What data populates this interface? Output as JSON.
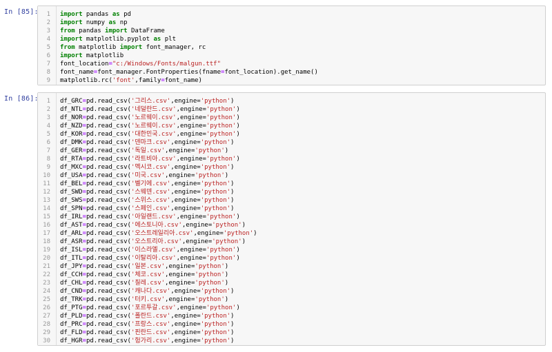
{
  "cells": [
    {
      "prompt": "In [85]:",
      "lines": [
        [
          {
            "t": "import",
            "c": "kw"
          },
          {
            "t": " pandas "
          },
          {
            "t": "as",
            "c": "kw"
          },
          {
            "t": " pd"
          }
        ],
        [
          {
            "t": "import",
            "c": "kw"
          },
          {
            "t": " numpy "
          },
          {
            "t": "as",
            "c": "kw"
          },
          {
            "t": " np"
          }
        ],
        [
          {
            "t": "from",
            "c": "kw"
          },
          {
            "t": " pandas "
          },
          {
            "t": "import",
            "c": "kw"
          },
          {
            "t": " DataFrame"
          }
        ],
        [
          {
            "t": "import",
            "c": "kw"
          },
          {
            "t": " matplotlib.pyplot "
          },
          {
            "t": "as",
            "c": "kw"
          },
          {
            "t": " plt"
          }
        ],
        [
          {
            "t": "from",
            "c": "kw"
          },
          {
            "t": " matplotlib "
          },
          {
            "t": "import",
            "c": "kw"
          },
          {
            "t": " font_manager, rc"
          }
        ],
        [
          {
            "t": "import",
            "c": "kw"
          },
          {
            "t": " matplotlib"
          }
        ],
        [
          {
            "t": "font_location"
          },
          {
            "t": "=",
            "c": "op"
          },
          {
            "t": "\"c:/Windows/Fonts/malgun.ttf\"",
            "c": "str"
          }
        ],
        [
          {
            "t": "font_name"
          },
          {
            "t": "=",
            "c": "op"
          },
          {
            "t": "font_manager.FontProperties(fname"
          },
          {
            "t": "=",
            "c": "op"
          },
          {
            "t": "font_location).get_name()"
          }
        ],
        [
          {
            "t": "matplotlib.rc("
          },
          {
            "t": "'font'",
            "c": "str"
          },
          {
            "t": ",family"
          },
          {
            "t": "=",
            "c": "op"
          },
          {
            "t": "font_name)"
          }
        ]
      ]
    },
    {
      "prompt": "In [86]:",
      "read_csv": [
        {
          "var": "df_GRC",
          "file": "그리스.csv"
        },
        {
          "var": "df_NTL",
          "file": "네덜란드.csv"
        },
        {
          "var": "df_NOR",
          "file": "노르웨이.csv"
        },
        {
          "var": "df_NZD",
          "file": "노르웨이.csv"
        },
        {
          "var": "df_KOR",
          "file": "대한민국.csv"
        },
        {
          "var": "df_DMK",
          "file": "덴마크.csv"
        },
        {
          "var": "df_GER",
          "file": "독일.csv"
        },
        {
          "var": "df_RTA",
          "file": "라트비아.csv"
        },
        {
          "var": "df_MXC",
          "file": "멕시코.csv"
        },
        {
          "var": "df_USA",
          "file": "미국.csv"
        },
        {
          "var": "df_BEL",
          "file": "벨기에.csv"
        },
        {
          "var": "df_SWD",
          "file": "스웨덴.csv"
        },
        {
          "var": "df_SWS",
          "file": "스위스.csv"
        },
        {
          "var": "df_SPN",
          "file": "스페인.csv"
        },
        {
          "var": "df_IRL",
          "file": "아일랜드.csv"
        },
        {
          "var": "df_AST",
          "file": "에스토니아.csv"
        },
        {
          "var": "df_ARL",
          "file": "오스트레일리아.csv"
        },
        {
          "var": "df_ASR",
          "file": "오스트리아.csv"
        },
        {
          "var": "df_ISL",
          "file": "이스라엘.csv"
        },
        {
          "var": "df_ITL",
          "file": "이탈리아.csv"
        },
        {
          "var": "df_JPY",
          "file": "일본.csv"
        },
        {
          "var": "df_CCH",
          "file": "체코.csv"
        },
        {
          "var": "df_CHL",
          "file": "칠레.csv"
        },
        {
          "var": "df_CND",
          "file": "캐나다.csv"
        },
        {
          "var": "df_TRK",
          "file": "터키.csv"
        },
        {
          "var": "df_PTG",
          "file": "포르투갈.csv"
        },
        {
          "var": "df_PLD",
          "file": "폴란드.csv"
        },
        {
          "var": "df_PRC",
          "file": "프랑스.csv"
        },
        {
          "var": "df_FLD",
          "file": "핀란드.csv"
        },
        {
          "var": "df_HGR",
          "file": "헝가리.csv"
        }
      ],
      "read_fn": "pd.read_csv(",
      "engine_arg": ",engine=",
      "engine_val": "'python'",
      "close": ")"
    }
  ]
}
